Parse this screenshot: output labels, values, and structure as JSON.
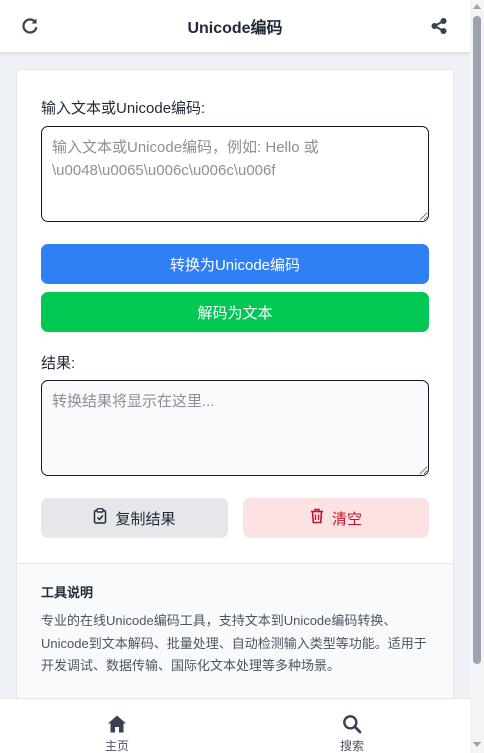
{
  "header": {
    "title": "Unicode编码",
    "left_icon": "refresh-icon",
    "right_icon": "share-icon"
  },
  "input": {
    "label": "输入文本或Unicode编码:",
    "placeholder": "输入文本或Unicode编码，例如: Hello 或 \\u0048\\u0065\\u006c\\u006c\\u006f",
    "value": ""
  },
  "actions": {
    "encode_label": "转换为Unicode编码",
    "decode_label": "解码为文本"
  },
  "result": {
    "label": "结果:",
    "placeholder": "转换结果将显示在这里...",
    "value": ""
  },
  "result_actions": {
    "copy_label": "复制结果",
    "copy_icon": "clipboard-icon",
    "clear_label": "清空",
    "clear_icon": "trash-icon"
  },
  "info": {
    "title": "工具说明",
    "text": "专业的在线Unicode编码工具，支持文本到Unicode编码转换、Unicode到文本解码、批量处理、自动检测输入类型等功能。适用于开发调试、数据传输、国际化文本处理等多种场景。"
  },
  "bottom_nav": {
    "items": [
      {
        "label": "主页",
        "icon": "home-icon"
      },
      {
        "label": "搜索",
        "icon": "search-icon"
      }
    ]
  },
  "colors": {
    "primary": "#2f7ff5",
    "success": "#00c853",
    "danger": "#c0142b",
    "danger_bg": "#fde2e3"
  }
}
